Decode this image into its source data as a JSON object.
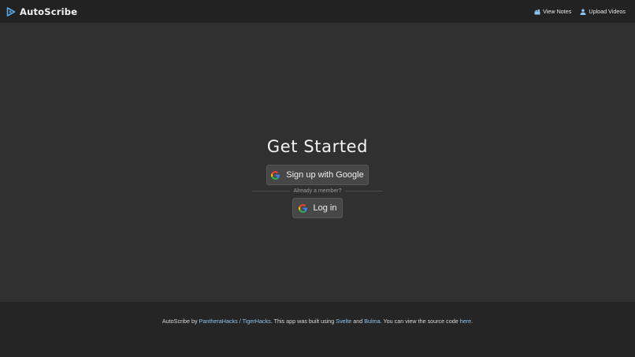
{
  "navbar": {
    "brand": "AutoScribe",
    "brand_icon": "play-triangle-icon",
    "links": [
      {
        "label": "View Notes",
        "icon": "notes-icon"
      },
      {
        "label": "Upload Videos",
        "icon": "user-upload-icon"
      }
    ]
  },
  "main": {
    "title": "Get Started",
    "signup_label": "Sign up with Google",
    "divider_text": "Already a member?",
    "login_label": "Log in"
  },
  "footer": {
    "prefix": "AutoScribe by ",
    "link_team": "PantheraHacks / TigerHacks",
    "mid1": ". This app was built using ",
    "link_svelte": "Svelte",
    "and": " and ",
    "link_bulma": "Bulma",
    "mid2": ". You can view the source code ",
    "link_here": "here",
    "suffix": "."
  },
  "colors": {
    "navbar_bg": "#222222",
    "page_bg": "#303030",
    "footer_bg": "#252525",
    "button_bg": "#474747",
    "link": "#8fc3ef",
    "brand_accent": "#5aa9e6"
  }
}
